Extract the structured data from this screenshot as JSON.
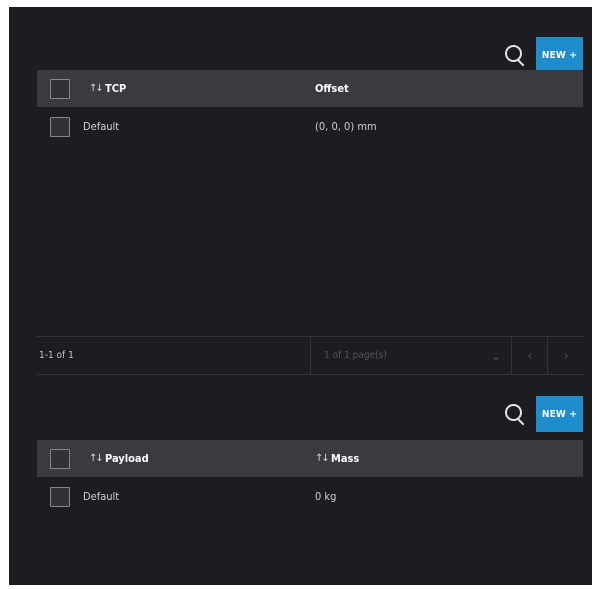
{
  "tcp_section": {
    "search_icon": "search-icon",
    "new_label": "NEW +",
    "sort_icon": "↑↓",
    "header": {
      "col1": "TCP",
      "col2": "Offset"
    },
    "rows": [
      {
        "name": "Default",
        "offset": "(0, 0, 0) mm"
      }
    ]
  },
  "pagination": {
    "count": "1-1 of 1",
    "page_select": "1 of 1 page(s)",
    "chevron": "⌄",
    "prev": "‹",
    "next": "›"
  },
  "payload_section": {
    "search_icon": "search-icon",
    "new_label": "NEW +",
    "sort_icon": "↑↓",
    "header": {
      "col1": "Payload",
      "col2": "Mass"
    },
    "rows": [
      {
        "name": "Default",
        "mass": "0 kg"
      }
    ]
  },
  "colors": {
    "background": "#1c1c21",
    "header": "#3a3a41",
    "accent": "#1f8ccb"
  }
}
